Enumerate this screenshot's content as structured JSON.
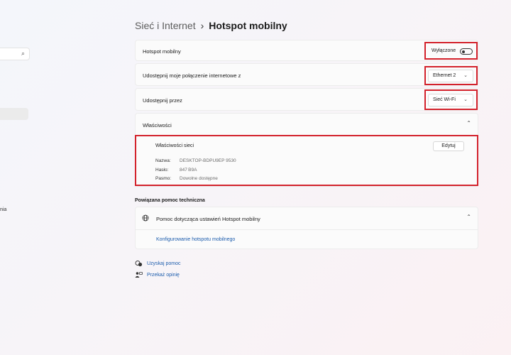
{
  "nav": {
    "search_icon": "search-icon",
    "cut_label": "nia"
  },
  "breadcrumb": {
    "parent": "Sieć i Internet",
    "separator": "›",
    "current": "Hotspot mobilny"
  },
  "hotspot": {
    "label": "Hotspot mobilny",
    "state": "Wyłączone"
  },
  "share_from": {
    "label": "Udostępnij moje połączenie internetowe z",
    "value": "Ethernet 2"
  },
  "share_over": {
    "label": "Udostępnij przez",
    "value": "Sieć Wi-Fi"
  },
  "properties": {
    "header": "Właściwości",
    "network_title": "Właściwości sieci",
    "edit_button": "Edytuj",
    "rows": [
      {
        "key": "Nazwa:",
        "value": "DESKTOP-BDPU9EP 9530"
      },
      {
        "key": "Hasło:",
        "value": "847 B9A"
      },
      {
        "key": "Pasmo:",
        "value": "Dowolne dostępne"
      }
    ]
  },
  "related": {
    "header": "Powiązana pomoc techniczna",
    "help_item": "Pomoc dotycząca ustawień Hotspot mobilny",
    "help_link": "Konfigurowanie hotspotu mobilnego"
  },
  "footer": {
    "get_help": "Uzyskaj pomoc",
    "feedback": "Przekaż opinię"
  },
  "colors": {
    "highlight": "#d3222c",
    "link": "#1d5dad"
  }
}
